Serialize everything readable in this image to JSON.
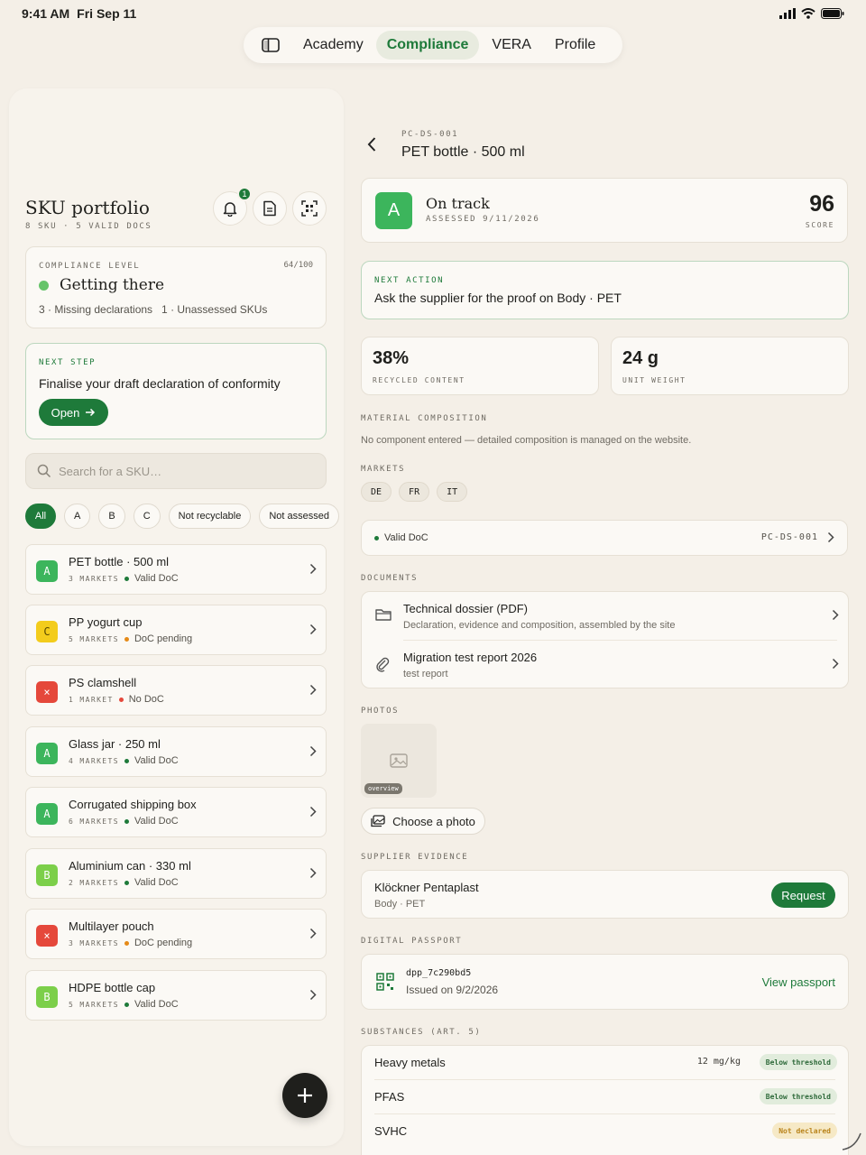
{
  "status": {
    "time": "9:41 AM",
    "date": "Fri Sep 11"
  },
  "nav": {
    "tabs": [
      "Academy",
      "Compliance",
      "VERA",
      "Profile"
    ],
    "active": "Compliance"
  },
  "portfolio": {
    "title": "SKU portfolio",
    "sku_count": "8 SKU",
    "sep": "·",
    "valid_docs": "5 VALID DOCS",
    "notif_count": "1"
  },
  "compliance": {
    "label": "COMPLIANCE LEVEL",
    "score": "64/100",
    "level": "Getting there",
    "level_color": "#66c46a",
    "stats": "3 · Missing declarations   1 · Unassessed SKUs"
  },
  "next_step": {
    "label": "NEXT STEP",
    "text": "Finalise your draft declaration of conformity",
    "button": "Open"
  },
  "search": {
    "placeholder": "Search for a SKU…"
  },
  "filters": [
    "All",
    "A",
    "B",
    "C",
    "Not recyclable",
    "Not assessed"
  ],
  "colors": {
    "A": "#3cb55c",
    "B": "#7ccf4a",
    "C": "#f3cc1c",
    "X": "#e5483b",
    "accent": "#1e7a3a"
  },
  "skus": [
    {
      "grade": "A",
      "name": "PET bottle · 500 ml",
      "markets": "3 MARKETS",
      "doc": "Valid DoC",
      "doc_color": "#1e7a3a"
    },
    {
      "grade": "C",
      "name": "PP yogurt cup",
      "markets": "5 MARKETS",
      "doc": "DoC pending",
      "doc_color": "#e58a18"
    },
    {
      "grade": "×",
      "name": "PS clamshell",
      "markets": "1 MARKET",
      "doc": "No DoC",
      "doc_color": "#e5483b"
    },
    {
      "grade": "A",
      "name": "Glass jar · 250 ml",
      "markets": "4 MARKETS",
      "doc": "Valid DoC",
      "doc_color": "#1e7a3a"
    },
    {
      "grade": "A",
      "name": "Corrugated shipping box",
      "markets": "6 MARKETS",
      "doc": "Valid DoC",
      "doc_color": "#1e7a3a"
    },
    {
      "grade": "B",
      "name": "Aluminium can · 330 ml",
      "markets": "2 MARKETS",
      "doc": "Valid DoC",
      "doc_color": "#1e7a3a"
    },
    {
      "grade": "×",
      "name": "Multilayer pouch",
      "markets": "3 MARKETS",
      "doc": "DoC pending",
      "doc_color": "#e58a18"
    },
    {
      "grade": "B",
      "name": "HDPE bottle cap",
      "markets": "5 MARKETS",
      "doc": "Valid DoC",
      "doc_color": "#1e7a3a"
    }
  ],
  "detail": {
    "code": "PC-DS-001",
    "title": "PET bottle · 500 ml",
    "grade": "A",
    "status": "On track",
    "assessed": "ASSESSED 9/11/2026",
    "score": "96",
    "score_label": "SCORE",
    "next_action_label": "NEXT ACTION",
    "next_action": "Ask the supplier for the proof on Body · PET",
    "recycled": "38%",
    "recycled_label": "RECYCLED CONTENT",
    "weight": "24 g",
    "weight_label": "UNIT WEIGHT",
    "material_label": "MATERIAL COMPOSITION",
    "material_note": "No component entered — detailed composition is managed on the website.",
    "markets_label": "MARKETS",
    "markets": [
      "DE",
      "FR",
      "IT"
    ],
    "doc_status": "Valid DoC",
    "doc_code": "PC-DS-001",
    "documents_label": "DOCUMENTS",
    "documents": [
      {
        "title": "Technical dossier (PDF)",
        "sub": "Declaration, evidence and composition, assembled by the site"
      },
      {
        "title": "Migration test report 2026",
        "sub": "test report"
      }
    ],
    "photos_label": "PHOTOS",
    "photo_tag": "overview",
    "choose_photo": "Choose a photo",
    "supplier_label": "SUPPLIER EVIDENCE",
    "supplier_name": "Klöckner Pentaplast",
    "supplier_part": "Body · PET",
    "request": "Request",
    "passport_label": "DIGITAL PASSPORT",
    "passport_id": "dpp_7c290bd5",
    "passport_issued": "Issued on 9/2/2026",
    "view_passport": "View passport",
    "substances_label": "SUBSTANCES (ART. 5)",
    "substances": [
      {
        "name": "Heavy metals",
        "value": "12 mg/kg",
        "status": "Below threshold",
        "kind": "ok"
      },
      {
        "name": "PFAS",
        "value": "",
        "status": "Below threshold",
        "kind": "ok"
      },
      {
        "name": "SVHC",
        "value": "",
        "status": "Not declared",
        "kind": "warn"
      }
    ]
  }
}
